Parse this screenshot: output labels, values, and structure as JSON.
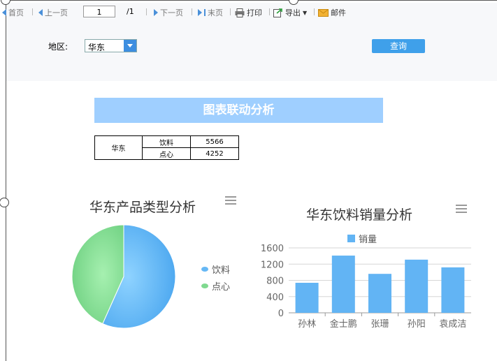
{
  "toolbar": {
    "first": "首页",
    "prev": "上一页",
    "page_value": "1",
    "page_total": "/1",
    "next": "下一页",
    "last": "末页",
    "print": "打印",
    "export": "导出",
    "mail": "邮件"
  },
  "filter": {
    "region_label": "地区:",
    "region_value": "华东",
    "query_label": "查询"
  },
  "report": {
    "title": "图表联动分析",
    "table": {
      "region": "华东",
      "rows": [
        {
          "category": "饮料",
          "value": "5566"
        },
        {
          "category": "点心",
          "value": "4252"
        }
      ]
    }
  },
  "colors": {
    "accent": "#3fa0ea",
    "title_bar": "#9fcfff",
    "pie_drinks": "#66b8f5",
    "pie_snacks": "#7fd98f",
    "bars": "#62b4f4"
  },
  "icons": {
    "print": "printer-icon",
    "export": "export-icon",
    "mail": "mail-icon",
    "menu": "hamburger-menu-icon"
  },
  "chart_data": [
    {
      "type": "pie",
      "title": "华东产品类型分析",
      "categories": [
        "饮料",
        "点心"
      ],
      "values": [
        5566,
        4252
      ],
      "legend": "right"
    },
    {
      "type": "bar",
      "title": "华东饮料销量分析",
      "categories": [
        "孙林",
        "金士鹏",
        "张珊",
        "孙阳",
        "袁成洁"
      ],
      "series": [
        {
          "name": "销量",
          "values": [
            740,
            1410,
            960,
            1310,
            1120
          ]
        }
      ],
      "ylim": [
        0,
        1600
      ],
      "yticks": [
        "0",
        "400",
        "800",
        "1200",
        "1600"
      ],
      "grid": true,
      "legend": "top"
    }
  ]
}
